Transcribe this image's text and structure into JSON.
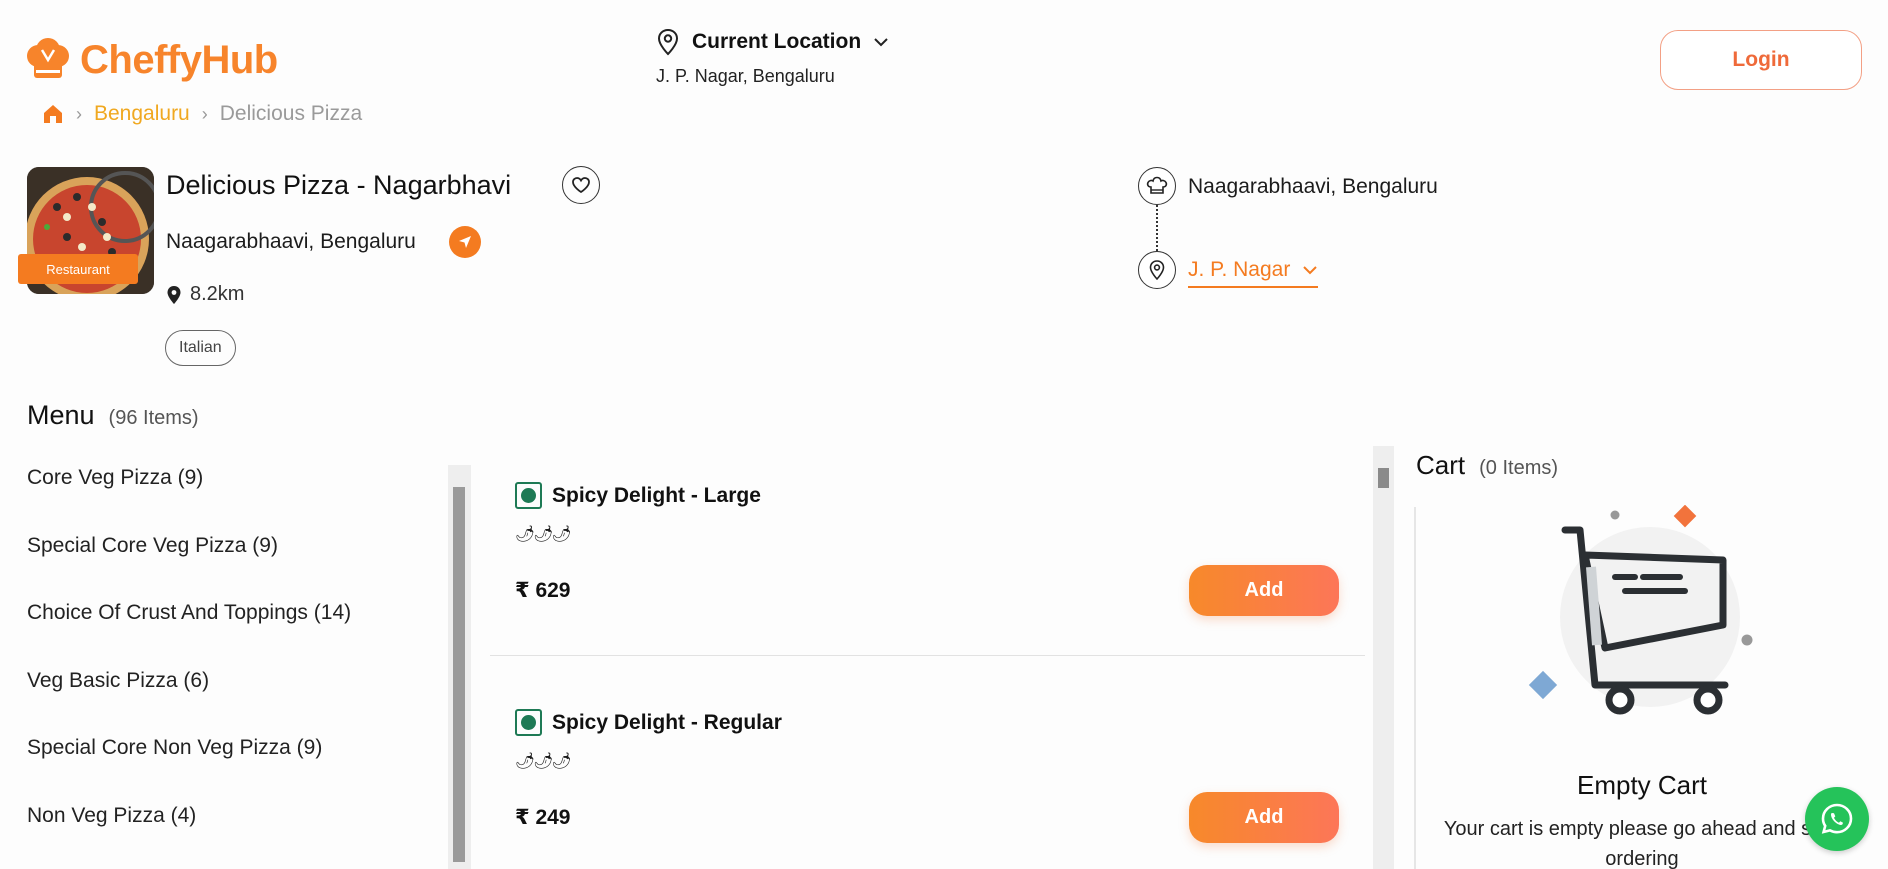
{
  "header": {
    "brand": "CheffyHub",
    "location_title": "Current Location",
    "location_address": "J. P. Nagar, Bengaluru",
    "login_label": "Login"
  },
  "breadcrumb": {
    "city": "Bengaluru",
    "current": "Delicious Pizza"
  },
  "restaurant": {
    "name": "Delicious Pizza - Nagarbhavi",
    "area": "Naagarabhaavi, Bengaluru",
    "distance": "8.2km",
    "tag": "Restaurant",
    "cuisines": [
      "Italian"
    ]
  },
  "route": {
    "from": "Naagarabhaavi, Bengaluru",
    "to": "J. P. Nagar"
  },
  "menu": {
    "title": "Menu",
    "count": "(96 Items)",
    "categories": [
      "Core Veg Pizza (9)",
      "Special Core Veg Pizza (9)",
      "Choice Of Crust And Toppings (14)",
      "Veg Basic Pizza (6)",
      "Special Core Non Veg Pizza (9)",
      "Non Veg Pizza (4)"
    ],
    "items": [
      {
        "name": "Spicy Delight - Large",
        "spice": "🌶🌶🌶",
        "price": "₹ 629",
        "add_label": "Add"
      },
      {
        "name": "Spicy Delight - Regular",
        "spice": "🌶🌶🌶",
        "price": "₹ 249",
        "add_label": "Add"
      }
    ]
  },
  "cart": {
    "title": "Cart",
    "count": "(0 Items)",
    "empty_title": "Empty Cart",
    "empty_message": "Your cart is empty please go ahead and start ordering"
  },
  "colors": {
    "brand": "#f7842b",
    "accent": "#f47b20",
    "veg": "#1e7a55",
    "whatsapp": "#25c35a"
  }
}
